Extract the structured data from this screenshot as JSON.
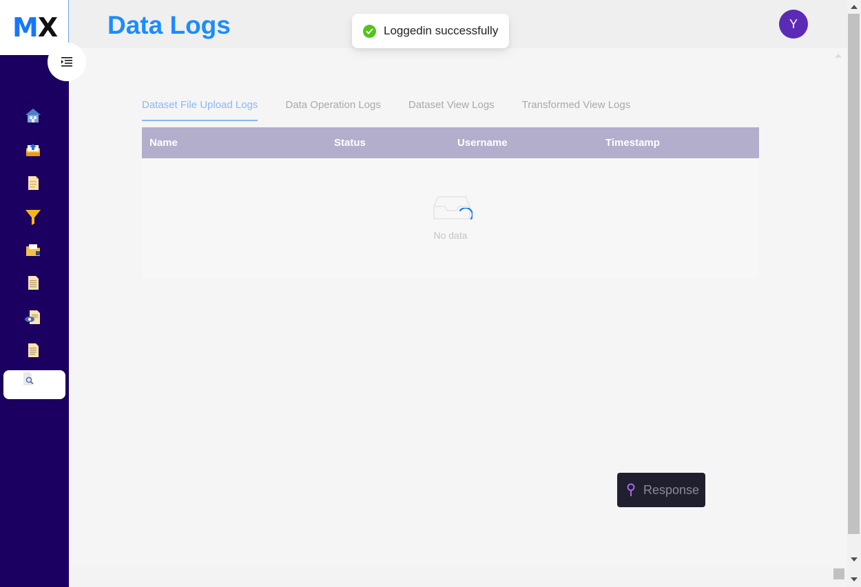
{
  "app": {
    "logo_m": "M",
    "logo_x": "X",
    "page_title": "Data Logs",
    "avatar_letter": "Y"
  },
  "toast": {
    "message": "Loggedin successfully",
    "status_color": "#52c41a"
  },
  "sidebar": {
    "background": "#1b0061",
    "items": [
      {
        "icon": "home-icon"
      },
      {
        "icon": "upload-inbox-icon"
      },
      {
        "icon": "document-icon"
      },
      {
        "icon": "filter-icon"
      },
      {
        "icon": "folder-lock-icon"
      },
      {
        "icon": "file-list-icon"
      },
      {
        "icon": "file-view-icon"
      },
      {
        "icon": "file-text-icon"
      },
      {
        "icon": "file-search-icon",
        "active": true
      }
    ]
  },
  "tabs": [
    {
      "label": "Dataset File Upload Logs",
      "active": true
    },
    {
      "label": "Data Operation Logs"
    },
    {
      "label": "Dataset View Logs"
    },
    {
      "label": "Transformed View Logs"
    }
  ],
  "table": {
    "columns": [
      "Name",
      "Status",
      "Username",
      "Timestamp"
    ],
    "empty_text": "No data",
    "header_color": "#b4aecd"
  },
  "response_button": {
    "label": "Response"
  },
  "colors": {
    "accent": "#1a8cff",
    "avatar": "#5b2bb5"
  }
}
